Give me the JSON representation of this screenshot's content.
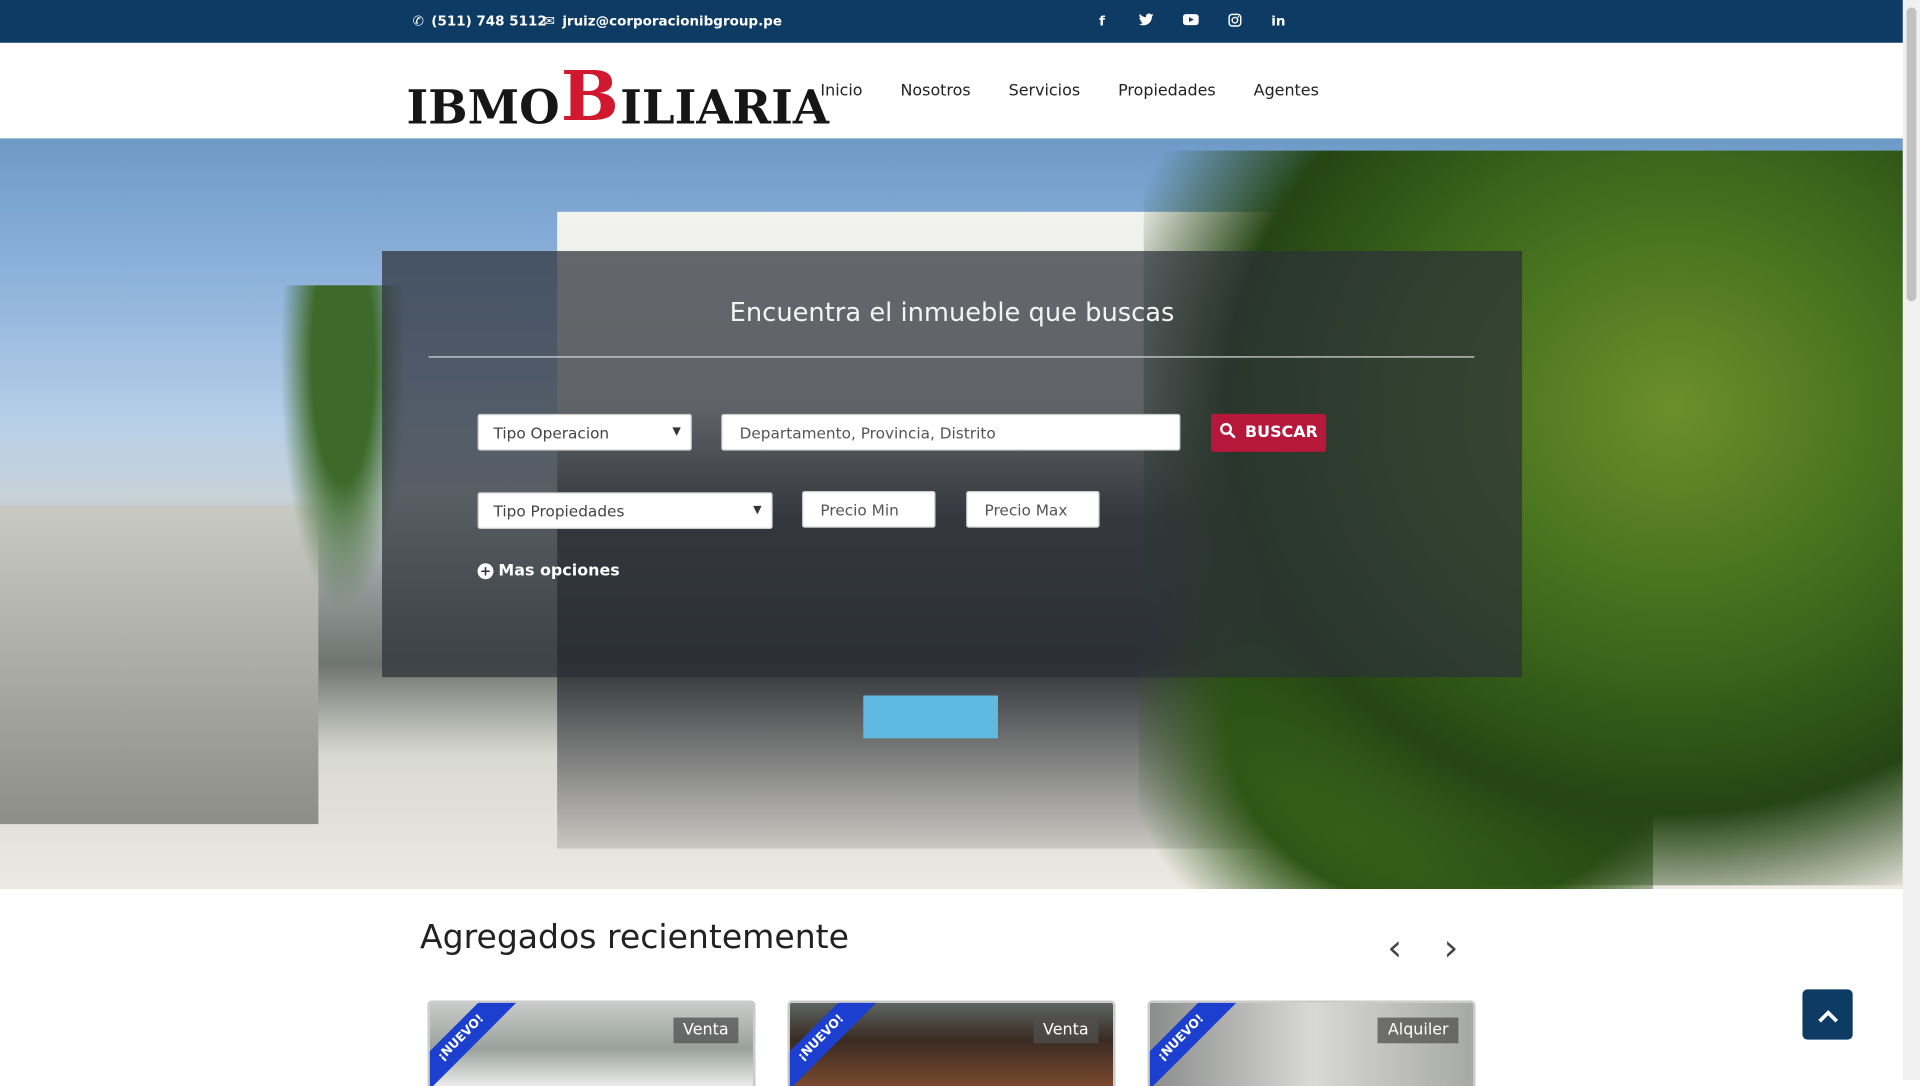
{
  "topbar": {
    "phone": "(511) 748 5112",
    "email": "jruiz@corporacionibgroup.pe",
    "socials": [
      {
        "icon": "facebook-icon",
        "glyph": "f"
      },
      {
        "icon": "twitter-icon",
        "glyph": "🐦"
      },
      {
        "icon": "youtube-icon",
        "glyph": "▶"
      },
      {
        "icon": "instagram-icon",
        "glyph": "◎"
      },
      {
        "icon": "linkedin-icon",
        "glyph": "in"
      }
    ]
  },
  "header": {
    "logo": {
      "part1": "IBMO",
      "part2": "B",
      "part3": "ILIARIA"
    },
    "nav": [
      "Inicio",
      "Nosotros",
      "Servicios",
      "Propiedades",
      "Agentes"
    ]
  },
  "search": {
    "title": "Encuentra el inmueble que buscas",
    "tipo_operacion": "Tipo Operacion",
    "location_placeholder": "Departamento, Provincia, Distrito",
    "buscar": "BUSCAR",
    "tipo_propiedades": "Tipo Propiedades",
    "precio_min": "Precio Min",
    "precio_max": "Precio Max",
    "mas_opciones": "Mas opciones"
  },
  "recent": {
    "title": "Agregados recientemente",
    "cards": [
      {
        "ribbon": "¡NUEVO!",
        "badge": "Venta"
      },
      {
        "ribbon": "¡NUEVO!",
        "badge": "Venta"
      },
      {
        "ribbon": "¡NUEVO!",
        "badge": "Alquiler"
      }
    ]
  },
  "colors": {
    "topbar": "#0d3b63",
    "accent": "#b5183a",
    "ribbon": "#1d3fd0"
  }
}
